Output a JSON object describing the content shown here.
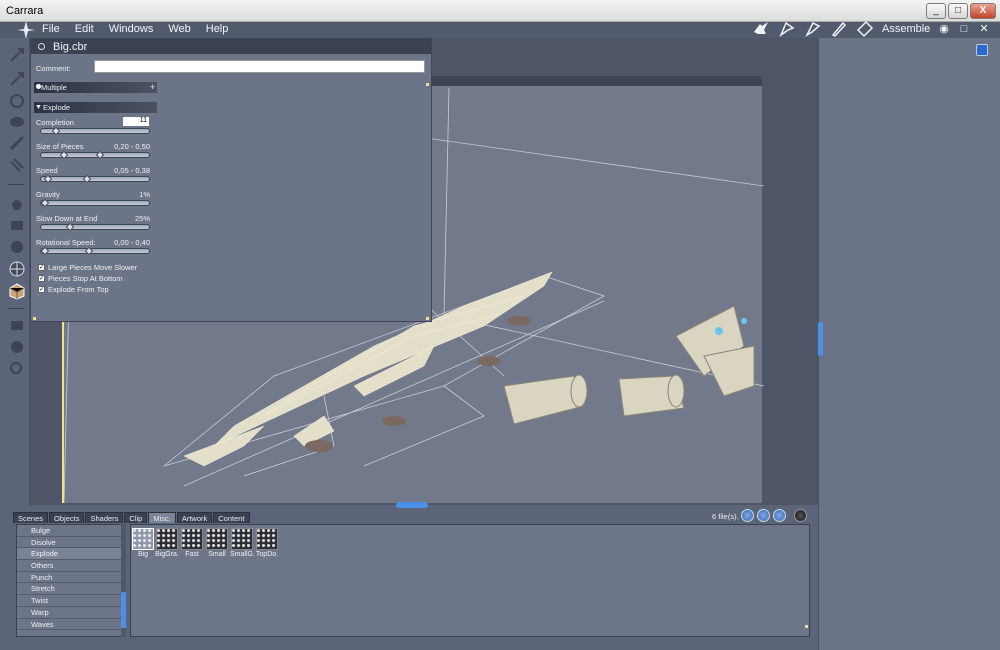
{
  "window": {
    "title": "Carrara",
    "min": "_",
    "max": "□",
    "close": "X"
  },
  "menu": {
    "items": [
      "File",
      "Edit",
      "Windows",
      "Web",
      "Help"
    ],
    "room": "Assemble",
    "right_icons": [
      "eye-icon",
      "restore-icon",
      "close-icon"
    ]
  },
  "panel": {
    "title": "Big.cbr",
    "comment_label": "Comment:",
    "comment_value": "",
    "multiple_label": "Multiple",
    "explode_label": "Explode",
    "params": [
      {
        "label": "Completion",
        "value": "11"
      },
      {
        "label": "Size of Pieces",
        "value": "0,20 - 0,50"
      },
      {
        "label": "Speed",
        "value": "0,05 - 0,38"
      },
      {
        "label": "Gravity",
        "value": "1%"
      },
      {
        "label": "Slow Down at End",
        "value": "25%"
      },
      {
        "label": "Rotational Speed:",
        "value": "0,00 - 0,40"
      }
    ],
    "checks": [
      {
        "label": "Large Pieces Move Slower",
        "checked": true
      },
      {
        "label": "Pieces Stop At Bottom",
        "checked": true
      },
      {
        "label": "Explode From Top",
        "checked": true
      }
    ]
  },
  "browser": {
    "tabs": [
      "Scenes",
      "Objects",
      "Shaders",
      "Clip",
      "Misc.",
      "Artwork",
      "Content"
    ],
    "active_tab": "Misc.",
    "files_count": "6 file(s).",
    "list": [
      "Bulge",
      "Disolve",
      "Explode",
      "Others",
      "Punch",
      "Stretch",
      "Twist",
      "Warp",
      "Waves"
    ],
    "selected_list": "Explode",
    "thumbs": [
      "Big",
      "BigGra.",
      "Fast",
      "Small",
      "SmallG.",
      "TopDo."
    ],
    "selected_thumb": "Big"
  }
}
